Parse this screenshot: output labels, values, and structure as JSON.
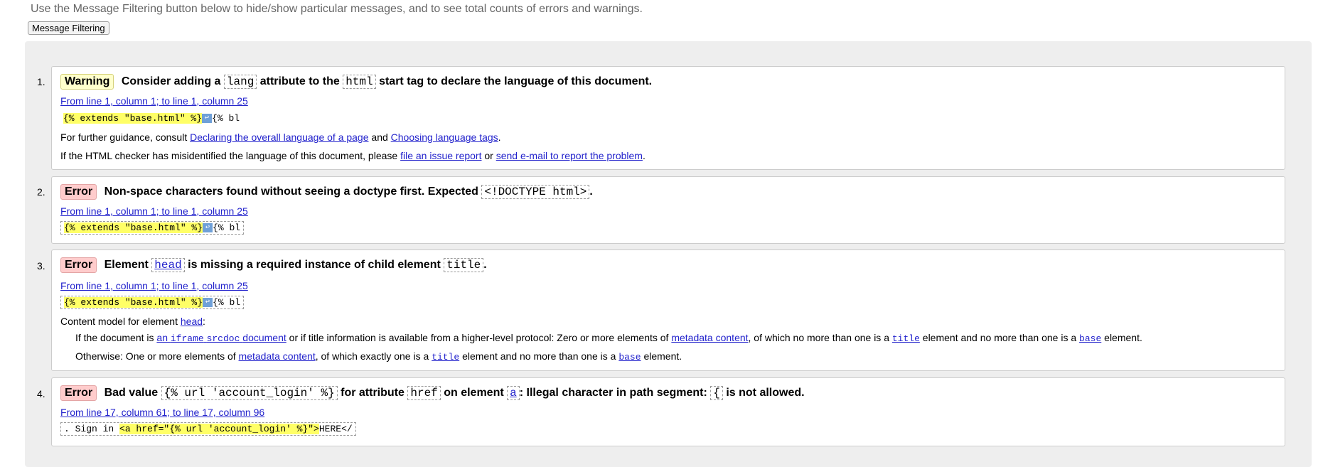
{
  "intro": "Use the Message Filtering button below to hide/show particular messages, and to see total counts of errors and warnings.",
  "filter_button": "Message Filtering",
  "messages": [
    {
      "num": "1.",
      "badge": "Warning",
      "h1": "Consider adding a",
      "c1": "lang",
      "h2": "attribute to the",
      "c2": "html",
      "h3": "start tag to declare the language of this document.",
      "location": "From line 1, column 1; to line 1, column 25",
      "extract_hl": "{% extends \"base.html\" %}",
      "extract_tail": "{% bl",
      "guidance_prefix": "For further guidance, consult",
      "link1": "Declaring the overall language of a page",
      "and": "and",
      "link2": "Choosing language tags",
      "period": ".",
      "misid_prefix": "If the HTML checker has misidentified the language of this document, please",
      "link3": "file an issue report",
      "or": "or",
      "link4": "send e-mail to report the problem",
      "period2": "."
    },
    {
      "num": "2.",
      "badge": "Error",
      "h1": "Non-space characters found without seeing a doctype first. Expected",
      "c1": "<!DOCTYPE html>",
      "h2": ".",
      "location": "From line 1, column 1; to line 1, column 25",
      "extract_hl": "{% extends \"base.html\" %}",
      "extract_tail": "{% bl"
    },
    {
      "num": "3.",
      "badge": "Error",
      "h1": "Element",
      "c1": "head",
      "h2": "is missing a required instance of child element",
      "c2": "title",
      "h3": ".",
      "location": "From line 1, column 1; to line 1, column 25",
      "extract_hl": "{% extends \"base.html\" %}",
      "extract_tail": "{% bl",
      "content_model_prefix": "Content model for element",
      "content_model_link": "head",
      "content_model_colon": ":",
      "cm1_a": "If the document is",
      "cm1_link_text": "an",
      "cm1_link_code1": "iframe",
      "cm1_link_code2": "srcdoc",
      "cm1_link_text2": "document",
      "cm1_b": "or if title information is available from a higher-level protocol: Zero or more elements of",
      "cm1_link_meta": "metadata content",
      "cm1_c": ", of which no more than one is a",
      "cm1_title": "title",
      "cm1_d": "element and no more than one is a",
      "cm1_base": "base",
      "cm1_e": "element.",
      "cm2_a": "Otherwise: One or more elements of",
      "cm2_link_meta": "metadata content",
      "cm2_b": ", of which exactly one is a",
      "cm2_title": "title",
      "cm2_c": "element and no more than one is a",
      "cm2_base": "base",
      "cm2_d": "element."
    },
    {
      "num": "4.",
      "badge": "Error",
      "h1": "Bad value",
      "c1": "{% url 'account_login' %}",
      "h2": "for attribute",
      "c2": "href",
      "h3": "on element",
      "c3": "a",
      "h4": ": Illegal character in path segment:",
      "c4": "{",
      "h5": "is not allowed.",
      "location": "From line 17, column 61; to line 17, column 96",
      "extract_pre": ". Sign in ",
      "extract_hl": "<a href=\"{% url 'account_login' %}\">",
      "extract_tail": "HERE</"
    }
  ]
}
